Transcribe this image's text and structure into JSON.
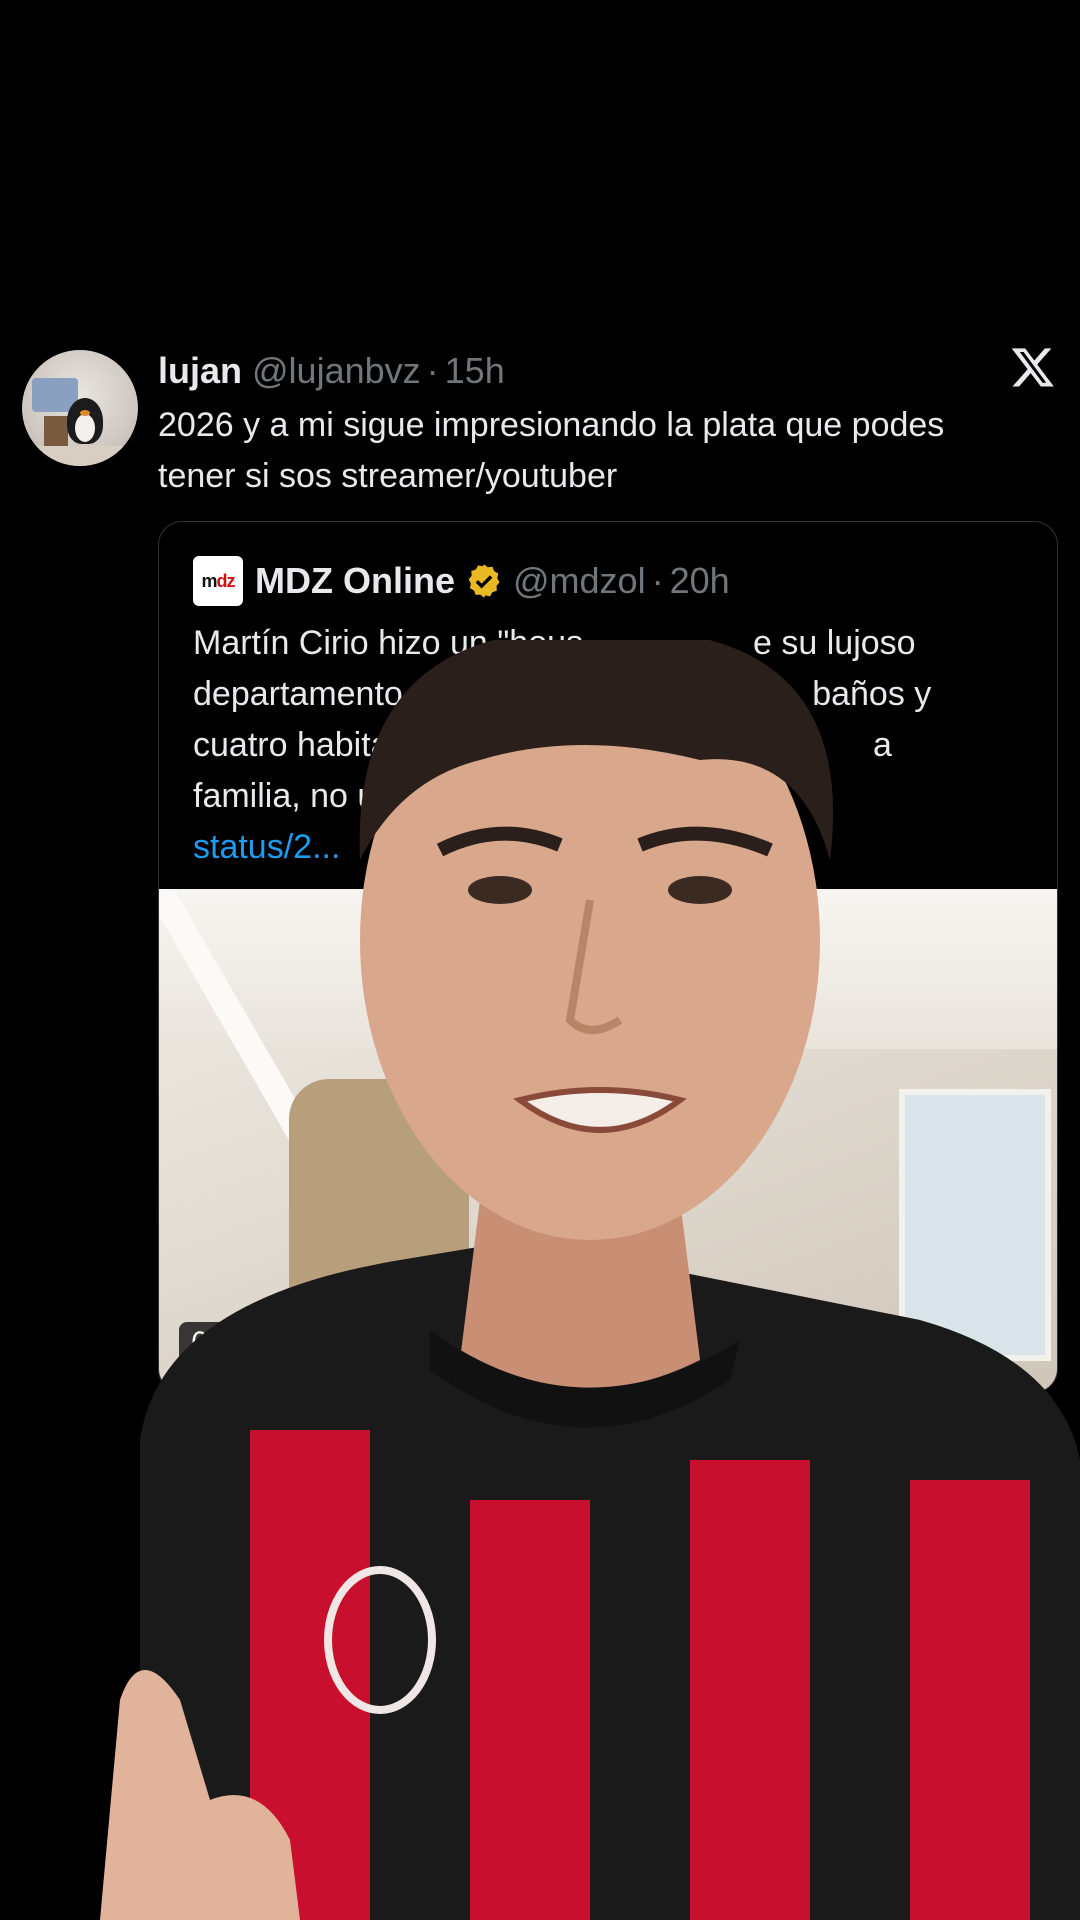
{
  "tweet": {
    "display_name": "lujan",
    "handle": "@lujanbvz",
    "separator": "·",
    "time": "15h",
    "text": "2026 y a mi sigue impresionando la plata que podes tener si sos streamer/youtuber",
    "avatar_icon": "penguin-avatar"
  },
  "platform_logo": "x-logo",
  "quote": {
    "logo_text_prefix": "m",
    "logo_text_accent": "dz",
    "display_name": "MDZ Online",
    "verified_icon": "verified-badge-icon",
    "handle": "@mdzol",
    "separator": "·",
    "time": "20h",
    "text_visible": "Martín Cirio hizo un \"hous",
    "text_line1_end": "e su lujoso",
    "text_line2_start": "departamento en B",
    "text_line2_end": "baños y",
    "text_line3_start": "cuatro habitacio",
    "text_line3_end": "a",
    "text_line4_start": "familia, no una",
    "link_text": "status/2...",
    "media_duration": "6:2"
  },
  "overlay": {
    "description_icon": "person-overlay",
    "colors": {
      "jersey_red": "#c8102e",
      "jersey_black": "#1a1a1a",
      "hair": "#2a1f1a",
      "skin": "#d9a78b"
    }
  },
  "colors": {
    "background": "#000000",
    "text": "#e7e9ea",
    "muted": "#71767b",
    "link": "#1d9bf0",
    "verified": "#e8b923"
  }
}
